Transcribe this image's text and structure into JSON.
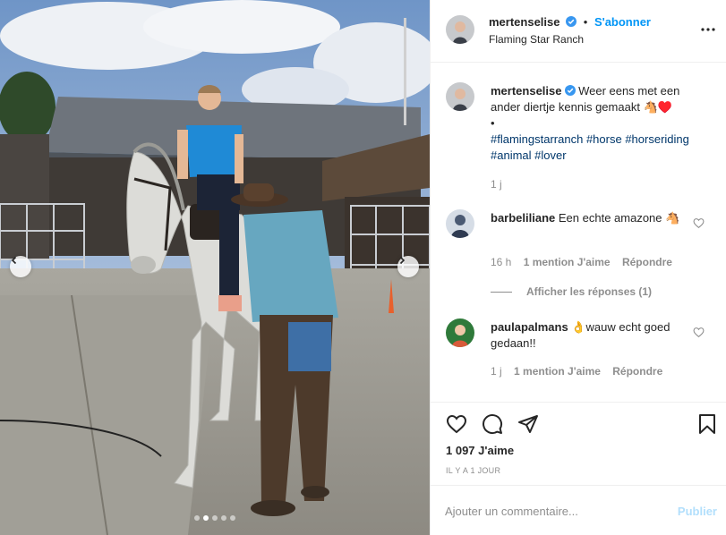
{
  "post": {
    "author": {
      "username": "mertenselise",
      "verified": true,
      "location": "Flaming Star Ranch",
      "follow_label": "S'abonner",
      "separator": "•"
    },
    "caption": {
      "username": "mertenselise",
      "text": "Weer eens met een ander diertje kennis gemaakt 🐴♥️",
      "bullet": "•",
      "hashtags": [
        "#flamingstarranch",
        "#horse",
        "#horseriding",
        "#animal",
        "#lover"
      ],
      "age": "1 j"
    },
    "comments": [
      {
        "username": "barbeliliane",
        "text": "Een echte amazone 🐴",
        "age": "16 h",
        "likes_label": "1 mention J'aime",
        "reply_label": "Répondre",
        "replies_toggle": "Afficher les réponses (1)"
      },
      {
        "username": "paulapalmans",
        "text": "👌wauw echt goed gedaan!!",
        "age": "1 j",
        "likes_label": "1 mention J'aime",
        "reply_label": "Répondre"
      }
    ],
    "likes": "1 097 J'aime",
    "timestamp": "IL Y A 1 JOUR",
    "add_comment_placeholder": "Ajouter un commentaire...",
    "publish_label": "Publier"
  },
  "carousel": {
    "slide_count": 5,
    "active_index": 1
  },
  "icons": {
    "more": "more-options-icon",
    "like": "heart-icon",
    "comment": "comment-icon",
    "share": "paper-plane-icon",
    "save": "bookmark-icon",
    "prev": "chevron-left-icon",
    "next": "chevron-right-icon"
  },
  "colors": {
    "link_blue": "#0095f6",
    "hashtag": "#00376b",
    "muted": "#8e8e8e",
    "publish_disabled": "#b2dffc"
  }
}
